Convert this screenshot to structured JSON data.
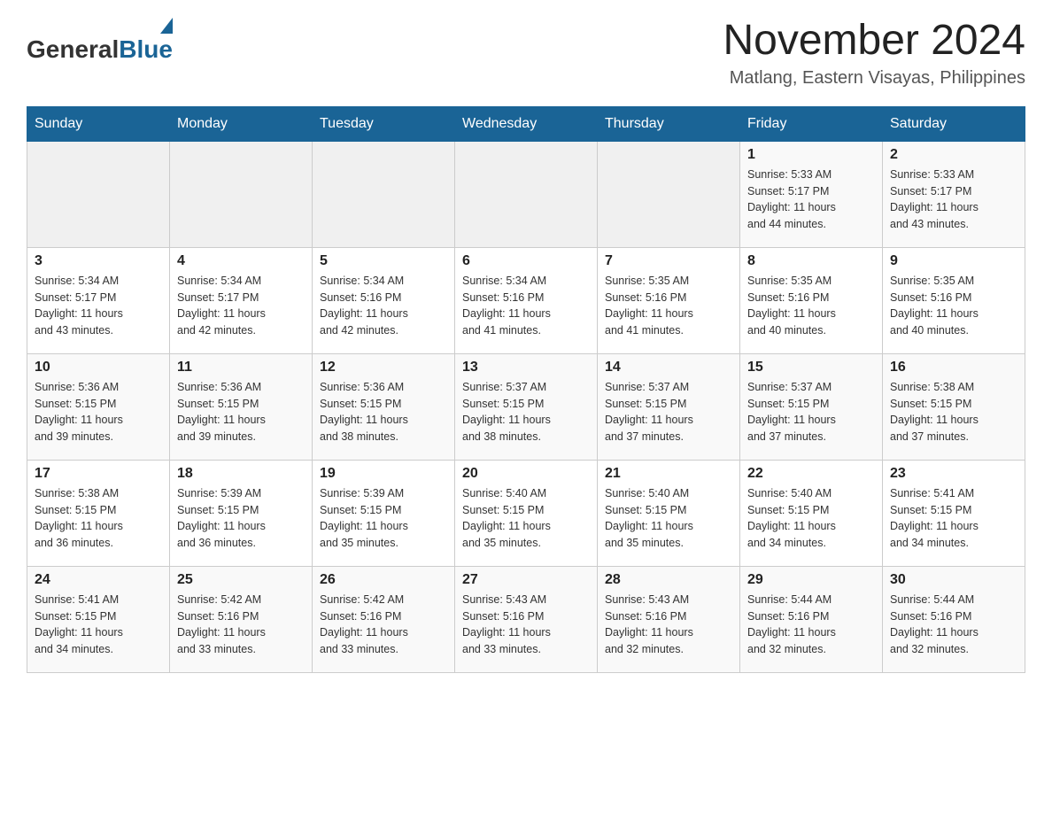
{
  "header": {
    "logo_general": "General",
    "logo_blue": "Blue",
    "month_year": "November 2024",
    "location": "Matlang, Eastern Visayas, Philippines"
  },
  "days_of_week": [
    "Sunday",
    "Monday",
    "Tuesday",
    "Wednesday",
    "Thursday",
    "Friday",
    "Saturday"
  ],
  "weeks": [
    [
      {
        "day": "",
        "info": ""
      },
      {
        "day": "",
        "info": ""
      },
      {
        "day": "",
        "info": ""
      },
      {
        "day": "",
        "info": ""
      },
      {
        "day": "",
        "info": ""
      },
      {
        "day": "1",
        "info": "Sunrise: 5:33 AM\nSunset: 5:17 PM\nDaylight: 11 hours\nand 44 minutes."
      },
      {
        "day": "2",
        "info": "Sunrise: 5:33 AM\nSunset: 5:17 PM\nDaylight: 11 hours\nand 43 minutes."
      }
    ],
    [
      {
        "day": "3",
        "info": "Sunrise: 5:34 AM\nSunset: 5:17 PM\nDaylight: 11 hours\nand 43 minutes."
      },
      {
        "day": "4",
        "info": "Sunrise: 5:34 AM\nSunset: 5:17 PM\nDaylight: 11 hours\nand 42 minutes."
      },
      {
        "day": "5",
        "info": "Sunrise: 5:34 AM\nSunset: 5:16 PM\nDaylight: 11 hours\nand 42 minutes."
      },
      {
        "day": "6",
        "info": "Sunrise: 5:34 AM\nSunset: 5:16 PM\nDaylight: 11 hours\nand 41 minutes."
      },
      {
        "day": "7",
        "info": "Sunrise: 5:35 AM\nSunset: 5:16 PM\nDaylight: 11 hours\nand 41 minutes."
      },
      {
        "day": "8",
        "info": "Sunrise: 5:35 AM\nSunset: 5:16 PM\nDaylight: 11 hours\nand 40 minutes."
      },
      {
        "day": "9",
        "info": "Sunrise: 5:35 AM\nSunset: 5:16 PM\nDaylight: 11 hours\nand 40 minutes."
      }
    ],
    [
      {
        "day": "10",
        "info": "Sunrise: 5:36 AM\nSunset: 5:15 PM\nDaylight: 11 hours\nand 39 minutes."
      },
      {
        "day": "11",
        "info": "Sunrise: 5:36 AM\nSunset: 5:15 PM\nDaylight: 11 hours\nand 39 minutes."
      },
      {
        "day": "12",
        "info": "Sunrise: 5:36 AM\nSunset: 5:15 PM\nDaylight: 11 hours\nand 38 minutes."
      },
      {
        "day": "13",
        "info": "Sunrise: 5:37 AM\nSunset: 5:15 PM\nDaylight: 11 hours\nand 38 minutes."
      },
      {
        "day": "14",
        "info": "Sunrise: 5:37 AM\nSunset: 5:15 PM\nDaylight: 11 hours\nand 37 minutes."
      },
      {
        "day": "15",
        "info": "Sunrise: 5:37 AM\nSunset: 5:15 PM\nDaylight: 11 hours\nand 37 minutes."
      },
      {
        "day": "16",
        "info": "Sunrise: 5:38 AM\nSunset: 5:15 PM\nDaylight: 11 hours\nand 37 minutes."
      }
    ],
    [
      {
        "day": "17",
        "info": "Sunrise: 5:38 AM\nSunset: 5:15 PM\nDaylight: 11 hours\nand 36 minutes."
      },
      {
        "day": "18",
        "info": "Sunrise: 5:39 AM\nSunset: 5:15 PM\nDaylight: 11 hours\nand 36 minutes."
      },
      {
        "day": "19",
        "info": "Sunrise: 5:39 AM\nSunset: 5:15 PM\nDaylight: 11 hours\nand 35 minutes."
      },
      {
        "day": "20",
        "info": "Sunrise: 5:40 AM\nSunset: 5:15 PM\nDaylight: 11 hours\nand 35 minutes."
      },
      {
        "day": "21",
        "info": "Sunrise: 5:40 AM\nSunset: 5:15 PM\nDaylight: 11 hours\nand 35 minutes."
      },
      {
        "day": "22",
        "info": "Sunrise: 5:40 AM\nSunset: 5:15 PM\nDaylight: 11 hours\nand 34 minutes."
      },
      {
        "day": "23",
        "info": "Sunrise: 5:41 AM\nSunset: 5:15 PM\nDaylight: 11 hours\nand 34 minutes."
      }
    ],
    [
      {
        "day": "24",
        "info": "Sunrise: 5:41 AM\nSunset: 5:15 PM\nDaylight: 11 hours\nand 34 minutes."
      },
      {
        "day": "25",
        "info": "Sunrise: 5:42 AM\nSunset: 5:16 PM\nDaylight: 11 hours\nand 33 minutes."
      },
      {
        "day": "26",
        "info": "Sunrise: 5:42 AM\nSunset: 5:16 PM\nDaylight: 11 hours\nand 33 minutes."
      },
      {
        "day": "27",
        "info": "Sunrise: 5:43 AM\nSunset: 5:16 PM\nDaylight: 11 hours\nand 33 minutes."
      },
      {
        "day": "28",
        "info": "Sunrise: 5:43 AM\nSunset: 5:16 PM\nDaylight: 11 hours\nand 32 minutes."
      },
      {
        "day": "29",
        "info": "Sunrise: 5:44 AM\nSunset: 5:16 PM\nDaylight: 11 hours\nand 32 minutes."
      },
      {
        "day": "30",
        "info": "Sunrise: 5:44 AM\nSunset: 5:16 PM\nDaylight: 11 hours\nand 32 minutes."
      }
    ]
  ]
}
